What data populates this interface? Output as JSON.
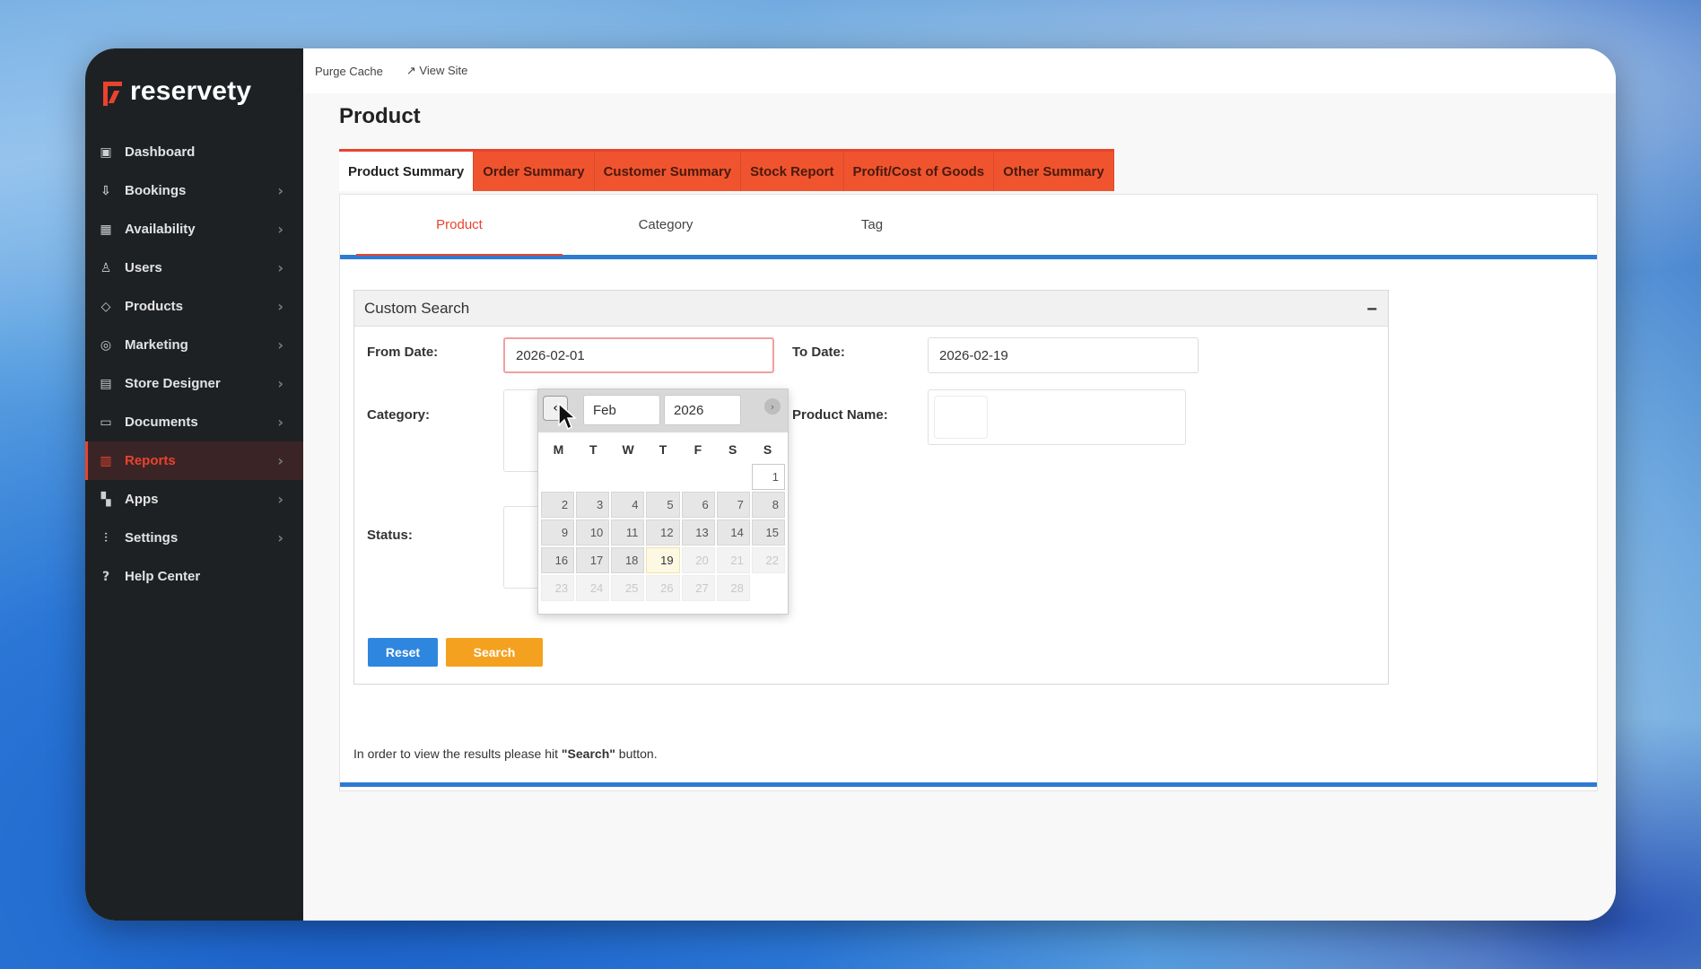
{
  "app": {
    "brand": "reservety",
    "colors": {
      "accent": "#e8432e",
      "sidebar_bg": "#1e2124",
      "tab_orange": "#f0542f",
      "link_blue": "#2e7bd1",
      "reset_btn": "#2f86de",
      "search_btn": "#f4a11f"
    }
  },
  "topbar": {
    "purge_cache": "Purge Cache",
    "view_site": "↗ View Site"
  },
  "sidebar": {
    "items": [
      {
        "label": "Dashboard",
        "icon": "dashboard-icon",
        "glyph": "▣",
        "chevron": false
      },
      {
        "label": "Bookings",
        "icon": "bookings-icon",
        "glyph": "⇩",
        "chevron": true
      },
      {
        "label": "Availability",
        "icon": "calendar-icon",
        "glyph": "▦",
        "chevron": true
      },
      {
        "label": "Users",
        "icon": "user-icon",
        "glyph": "♙",
        "chevron": true
      },
      {
        "label": "Products",
        "icon": "tag-icon",
        "glyph": "◇",
        "chevron": true
      },
      {
        "label": "Marketing",
        "icon": "marketing-icon",
        "glyph": "◎",
        "chevron": true
      },
      {
        "label": "Store Designer",
        "icon": "store-icon",
        "glyph": "▤",
        "chevron": true
      },
      {
        "label": "Documents",
        "icon": "documents-icon",
        "glyph": "▭",
        "chevron": true
      },
      {
        "label": "Reports",
        "icon": "reports-icon",
        "glyph": "▥",
        "chevron": true,
        "active": true
      },
      {
        "label": "Apps",
        "icon": "apps-icon",
        "glyph": "▚",
        "chevron": true
      },
      {
        "label": "Settings",
        "icon": "settings-icon",
        "glyph": "⫶",
        "chevron": true
      },
      {
        "label": "Help Center",
        "icon": "help-icon",
        "glyph": "?",
        "chevron": false
      }
    ]
  },
  "page": {
    "title": "Product"
  },
  "tabs": [
    "Product Summary",
    "Order Summary",
    "Customer Summary",
    "Stock Report",
    "Profit/Cost of Goods",
    "Other Summary"
  ],
  "subtabs": [
    "Product",
    "Category",
    "Tag"
  ],
  "search": {
    "header": "Custom Search",
    "collapse": "−",
    "from_label": "From Date:",
    "from_value": "2026-02-01",
    "to_label": "To Date:",
    "to_value": "2026-02-19",
    "category_label": "Category:",
    "product_name_label": "Product Name:",
    "status_label": "Status:",
    "reset": "Reset",
    "search": "Search"
  },
  "note": {
    "before": "In order to view the results please hit ",
    "bold": "\"Search\"",
    "after": " button."
  },
  "datepicker": {
    "month": "Feb",
    "year": "2026",
    "days_of_week": [
      "M",
      "T",
      "W",
      "T",
      "F",
      "S",
      "S"
    ],
    "weeks": [
      [
        "",
        "",
        "",
        "",
        "",
        "",
        "1"
      ],
      [
        "2",
        "3",
        "4",
        "5",
        "6",
        "7",
        "8"
      ],
      [
        "9",
        "10",
        "11",
        "12",
        "13",
        "14",
        "15"
      ],
      [
        "16",
        "17",
        "18",
        "19",
        "20",
        "21",
        "22"
      ],
      [
        "23",
        "24",
        "25",
        "26",
        "27",
        "28",
        ""
      ]
    ],
    "today": "19"
  }
}
